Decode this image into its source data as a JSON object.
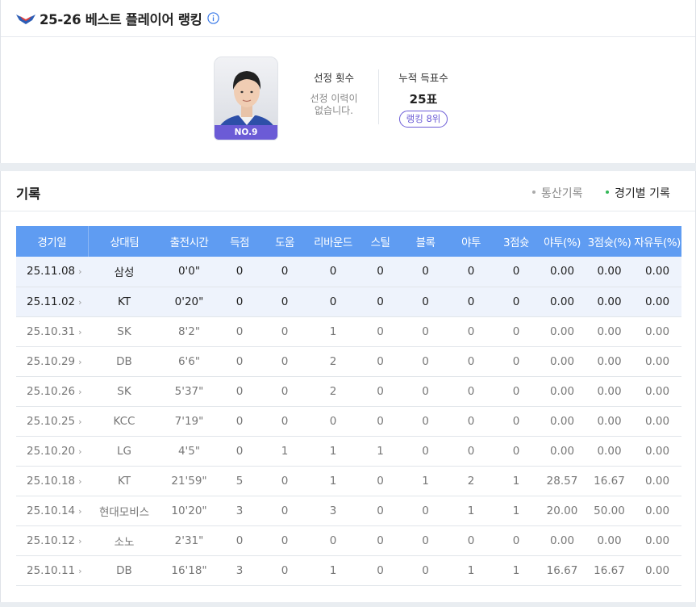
{
  "header": {
    "title": "25-26 베스트 플레이어 랭킹",
    "info_icon": "info-circle-icon",
    "logo_icon": "team-logo-icon"
  },
  "profile": {
    "card_number": "NO.9",
    "selection_count_label": "선정 횟수",
    "selection_msg_line1": "선정 이력이",
    "selection_msg_line2": "없습니다.",
    "votes_label": "누적 득표수",
    "votes_value": "25표",
    "rank_badge": "랭킹 8위"
  },
  "records": {
    "title": "기록",
    "tabs": [
      "통산기록",
      "경기별 기록"
    ],
    "active_tab": "경기별 기록",
    "columns": [
      "경기일",
      "상대팀",
      "출전시간",
      "득점",
      "도움",
      "리바운드",
      "스틸",
      "블록",
      "야투",
      "3점슛",
      "야투(%)",
      "3점슛(%)",
      "자유투(%)"
    ],
    "rows": [
      {
        "date": "25.11.08",
        "opp": "삼성",
        "time": "0'0\"",
        "pts": "0",
        "ast": "0",
        "reb": "0",
        "stl": "0",
        "blk": "0",
        "fg": "0",
        "tp": "0",
        "fgp": "0.00",
        "tpp": "0.00",
        "ftp": "0.00",
        "highlight": true
      },
      {
        "date": "25.11.02",
        "opp": "KT",
        "time": "0'20\"",
        "pts": "0",
        "ast": "0",
        "reb": "0",
        "stl": "0",
        "blk": "0",
        "fg": "0",
        "tp": "0",
        "fgp": "0.00",
        "tpp": "0.00",
        "ftp": "0.00",
        "highlight": true
      },
      {
        "date": "25.10.31",
        "opp": "SK",
        "time": "8'2\"",
        "pts": "0",
        "ast": "0",
        "reb": "1",
        "stl": "0",
        "blk": "0",
        "fg": "0",
        "tp": "0",
        "fgp": "0.00",
        "tpp": "0.00",
        "ftp": "0.00",
        "highlight": false
      },
      {
        "date": "25.10.29",
        "opp": "DB",
        "time": "6'6\"",
        "pts": "0",
        "ast": "0",
        "reb": "2",
        "stl": "0",
        "blk": "0",
        "fg": "0",
        "tp": "0",
        "fgp": "0.00",
        "tpp": "0.00",
        "ftp": "0.00",
        "highlight": false
      },
      {
        "date": "25.10.26",
        "opp": "SK",
        "time": "5'37\"",
        "pts": "0",
        "ast": "0",
        "reb": "2",
        "stl": "0",
        "blk": "0",
        "fg": "0",
        "tp": "0",
        "fgp": "0.00",
        "tpp": "0.00",
        "ftp": "0.00",
        "highlight": false
      },
      {
        "date": "25.10.25",
        "opp": "KCC",
        "time": "7'19\"",
        "pts": "0",
        "ast": "0",
        "reb": "0",
        "stl": "0",
        "blk": "0",
        "fg": "0",
        "tp": "0",
        "fgp": "0.00",
        "tpp": "0.00",
        "ftp": "0.00",
        "highlight": false
      },
      {
        "date": "25.10.20",
        "opp": "LG",
        "time": "4'5\"",
        "pts": "0",
        "ast": "1",
        "reb": "1",
        "stl": "1",
        "blk": "0",
        "fg": "0",
        "tp": "0",
        "fgp": "0.00",
        "tpp": "0.00",
        "ftp": "0.00",
        "highlight": false
      },
      {
        "date": "25.10.18",
        "opp": "KT",
        "time": "21'59\"",
        "pts": "5",
        "ast": "0",
        "reb": "1",
        "stl": "0",
        "blk": "1",
        "fg": "2",
        "tp": "1",
        "fgp": "28.57",
        "tpp": "16.67",
        "ftp": "0.00",
        "highlight": false
      },
      {
        "date": "25.10.14",
        "opp": "현대모비스",
        "time": "10'20\"",
        "pts": "3",
        "ast": "0",
        "reb": "3",
        "stl": "0",
        "blk": "0",
        "fg": "1",
        "tp": "1",
        "fgp": "20.00",
        "tpp": "50.00",
        "ftp": "0.00",
        "highlight": false
      },
      {
        "date": "25.10.12",
        "opp": "소노",
        "time": "2'31\"",
        "pts": "0",
        "ast": "0",
        "reb": "0",
        "stl": "0",
        "blk": "0",
        "fg": "0",
        "tp": "0",
        "fgp": "0.00",
        "tpp": "0.00",
        "ftp": "0.00",
        "highlight": false
      },
      {
        "date": "25.10.11",
        "opp": "DB",
        "time": "16'18\"",
        "pts": "3",
        "ast": "0",
        "reb": "1",
        "stl": "0",
        "blk": "0",
        "fg": "1",
        "tp": "1",
        "fgp": "16.67",
        "tpp": "16.67",
        "ftp": "0.00",
        "highlight": false
      }
    ]
  },
  "colors": {
    "accent": "#5f9cf2",
    "badge": "#6b5bd6",
    "active_dot": "#34b858"
  }
}
